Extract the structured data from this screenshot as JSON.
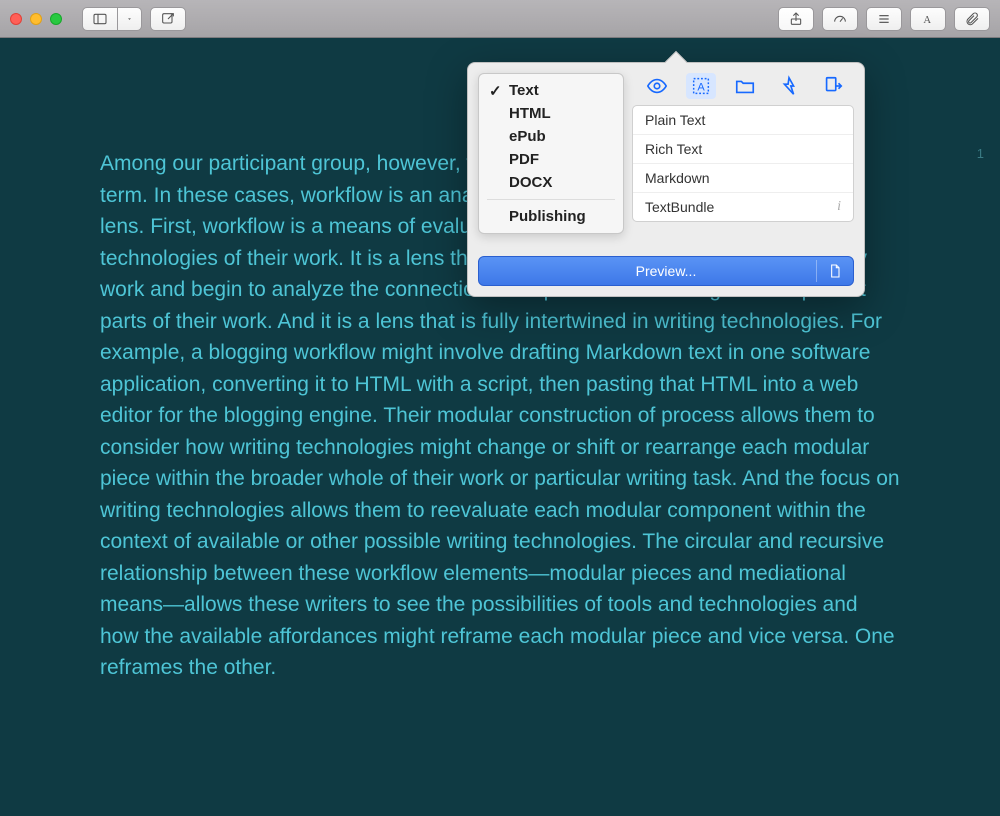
{
  "toolbar": {
    "sidebar_icon": "sidebar-icon",
    "compose_icon": "compose-icon",
    "share_icon": "share-icon",
    "gauge_icon": "gauge-icon",
    "lines_icon": "lines-icon",
    "font_icon": "font-icon",
    "clip_icon": "paperclip-icon"
  },
  "editor": {
    "body": "Among our participant group, however, we noticed a subtle reappropriation of the term. In these cases, workflow is an analytical process, rubric, and metacognitive lens. First, workflow is a means of evaluating the components, processes, and technologies of their work. It is a lens through which they can understand how they work and begin to analyze the connections and possibilities among the component parts of their work. And it is a lens that is fully intertwined in writing technologies. For example, a blogging workflow might involve drafting Markdown text in one software application, converting it to HTML with a script, then pasting that HTML into a web editor for the blogging engine. Their modular construction of process allows them to consider how writing technologies might change or shift or rearrange each modular piece within the broader whole of their work or particular writing task. And the focus on writing technologies allows them to reevaluate each modular component within the context of available or other possible writing technologies. The circular and recursive relationship between these workflow elements—modular pieces and mediational means—allows these writers to see the possibilities of tools and technologies and how the available affordances might reframe each modular piece and vice versa. One reframes the other.",
    "page_number": "1"
  },
  "popover": {
    "formats": [
      {
        "label": "Text",
        "selected": true
      },
      {
        "label": "HTML",
        "selected": false
      },
      {
        "label": "ePub",
        "selected": false
      },
      {
        "label": "PDF",
        "selected": false
      },
      {
        "label": "DOCX",
        "selected": false
      }
    ],
    "publishing_label": "Publishing",
    "list_items": [
      {
        "label": "Plain Text",
        "info": false
      },
      {
        "label": "Rich Text",
        "info": false
      },
      {
        "label": "Markdown",
        "info": false
      },
      {
        "label": "TextBundle",
        "info": true
      }
    ],
    "preview_button": "Preview..."
  }
}
